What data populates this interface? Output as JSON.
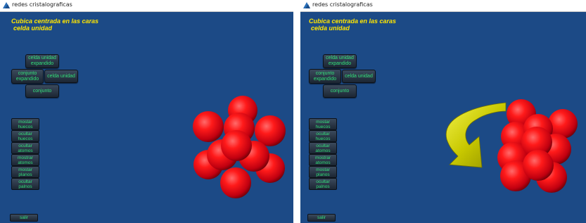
{
  "windows": [
    {
      "title": "redes cristalograficas",
      "heading_line1": "Cubica centrada en las caras",
      "heading_line2": "celda unidad",
      "buttons": {
        "celda_unidad_expandido": "celda unidad expandido",
        "conjunto_expandido": "conjunto expandido",
        "celda_unidad": "celda unidad",
        "conjunto": "conjunto"
      },
      "side_buttons": [
        "mostar huecos",
        "ocultar huecos",
        "ocultar atomos",
        "mostrar atomos",
        "mostar planos",
        "ocultar palnos"
      ],
      "exit_label": "salir"
    },
    {
      "title": "redes cristalograficas",
      "heading_line1": "Cubica centrada en las caras",
      "heading_line2": "celda unidad",
      "buttons": {
        "celda_unidad_expandido": "celda unidad expandido",
        "conjunto_expandido": "conjunto expandido",
        "celda_unidad": "celda unidad",
        "conjunto": "conjunto"
      },
      "side_buttons": [
        "mostar huecos",
        "ocultar huecos",
        "ocultar atomos",
        "mostrar atomos",
        "mostar planos",
        "ocultar palnos"
      ],
      "exit_label": "salir"
    }
  ],
  "colors": {
    "background": "#1c4a86",
    "heading": "#ffe600",
    "button_text": "#33e07a",
    "atom": "#e0101e",
    "arrow": "#c8c800"
  }
}
